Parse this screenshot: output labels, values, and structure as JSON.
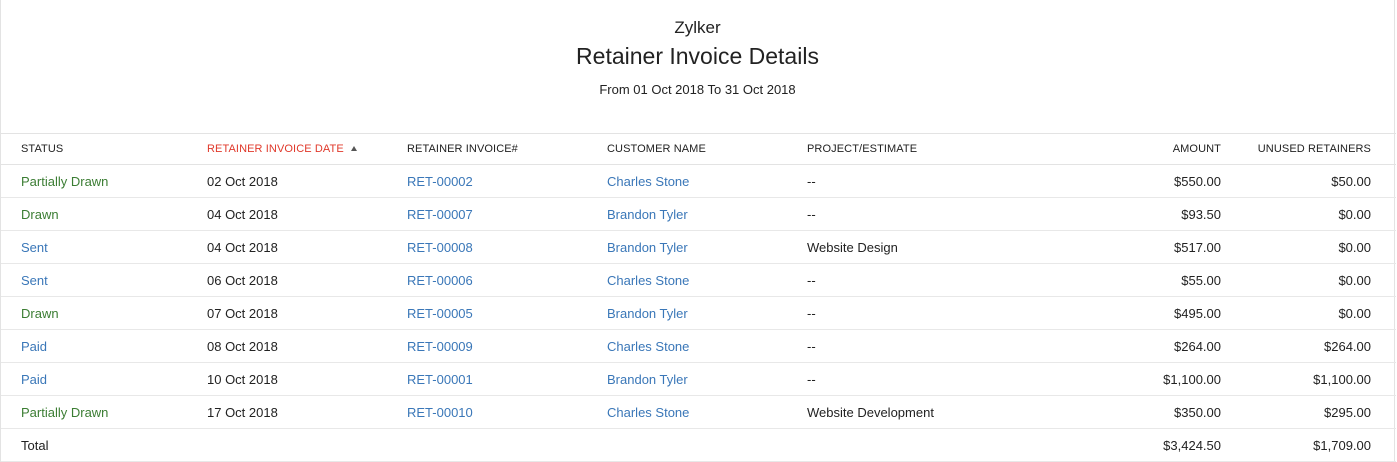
{
  "report": {
    "org_name": "Zylker",
    "title": "Retainer Invoice Details",
    "date_range": "From 01 Oct 2018 To 31 Oct 2018"
  },
  "columns": {
    "status": "STATUS",
    "date": "RETAINER INVOICE DATE",
    "invoice": "RETAINER INVOICE#",
    "customer": "CUSTOMER NAME",
    "project": "PROJECT/ESTIMATE",
    "amount": "AMOUNT",
    "unused": "UNUSED RETAINERS"
  },
  "sort": {
    "column": "date",
    "direction": "ascending",
    "icon": "sort-up-icon"
  },
  "colors": {
    "sorted_header": "#e0392b",
    "link": "#3a77b8",
    "status_green": "#3b7d33",
    "status_blue": "#3a77b8"
  },
  "rows": [
    {
      "status": "Partially Drawn",
      "date": "02 Oct 2018",
      "invoice": "RET-00002",
      "customer": "Charles Stone",
      "project": "--",
      "amount": "$550.00",
      "unused": "$50.00"
    },
    {
      "status": "Drawn",
      "date": "04 Oct 2018",
      "invoice": "RET-00007",
      "customer": "Brandon Tyler",
      "project": "--",
      "amount": "$93.50",
      "unused": "$0.00"
    },
    {
      "status": "Sent",
      "date": "04 Oct 2018",
      "invoice": "RET-00008",
      "customer": "Brandon Tyler",
      "project": "Website Design",
      "amount": "$517.00",
      "unused": "$0.00"
    },
    {
      "status": "Sent",
      "date": "06 Oct 2018",
      "invoice": "RET-00006",
      "customer": "Charles Stone",
      "project": "--",
      "amount": "$55.00",
      "unused": "$0.00"
    },
    {
      "status": "Drawn",
      "date": "07 Oct 2018",
      "invoice": "RET-00005",
      "customer": "Brandon Tyler",
      "project": "--",
      "amount": "$495.00",
      "unused": "$0.00"
    },
    {
      "status": "Paid",
      "date": "08 Oct 2018",
      "invoice": "RET-00009",
      "customer": "Charles Stone",
      "project": "--",
      "amount": "$264.00",
      "unused": "$264.00"
    },
    {
      "status": "Paid",
      "date": "10 Oct 2018",
      "invoice": "RET-00001",
      "customer": "Brandon Tyler",
      "project": "--",
      "amount": "$1,100.00",
      "unused": "$1,100.00"
    },
    {
      "status": "Partially Drawn",
      "date": "17 Oct 2018",
      "invoice": "RET-00010",
      "customer": "Charles Stone",
      "project": "Website Development",
      "amount": "$350.00",
      "unused": "$295.00"
    }
  ],
  "totals": {
    "label": "Total",
    "amount": "$3,424.50",
    "unused": "$1,709.00"
  }
}
